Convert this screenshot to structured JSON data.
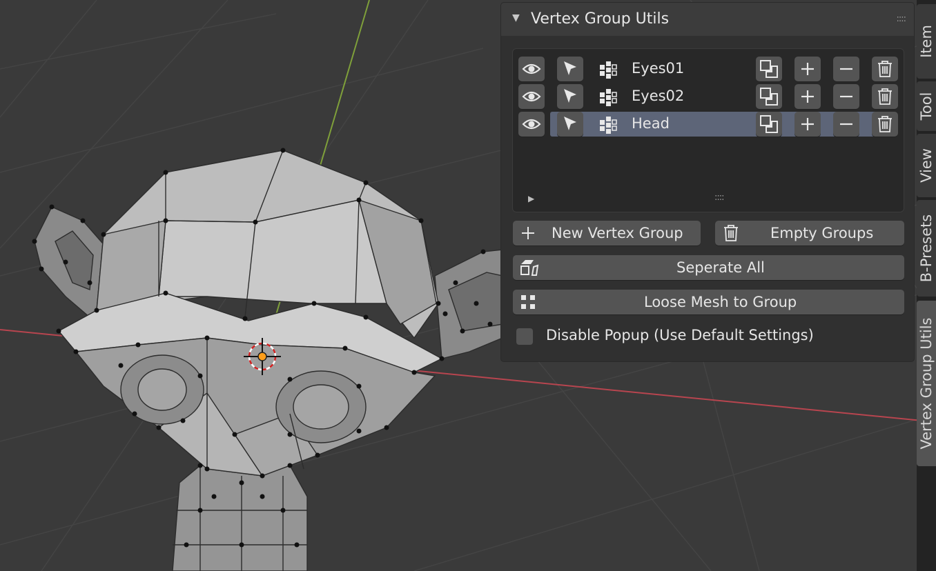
{
  "panel": {
    "title": "Vertex Group Utils",
    "collapse_glyph": "▼",
    "drag_glyph": "::::"
  },
  "vertex_groups": [
    {
      "name": "Eyes01",
      "selected": false
    },
    {
      "name": "Eyes02",
      "selected": false
    },
    {
      "name": "Head",
      "selected": true
    }
  ],
  "list_footer": {
    "expand_glyph": "▶",
    "grip_glyph": "::::"
  },
  "buttons": {
    "new_vertex_group": "New Vertex Group",
    "empty_groups": "Empty Groups",
    "seperate_all": "Seperate All",
    "loose_mesh_to_group": "Loose Mesh to Group"
  },
  "checkbox": {
    "label": "Disable Popup (Use Default Settings)",
    "checked": false
  },
  "tabs": [
    {
      "label": "Item",
      "active": false
    },
    {
      "label": "Tool",
      "active": false
    },
    {
      "label": "View",
      "active": false
    },
    {
      "label": "B-Presets",
      "active": false
    },
    {
      "label": "Vertex Group Utils",
      "active": true
    }
  ],
  "colors": {
    "viewport_bg": "#3a3a3a",
    "x_axis": "#b8454f",
    "y_axis": "#7fa03a",
    "selection": "#5d6578",
    "origin": "#ff9e1a"
  }
}
